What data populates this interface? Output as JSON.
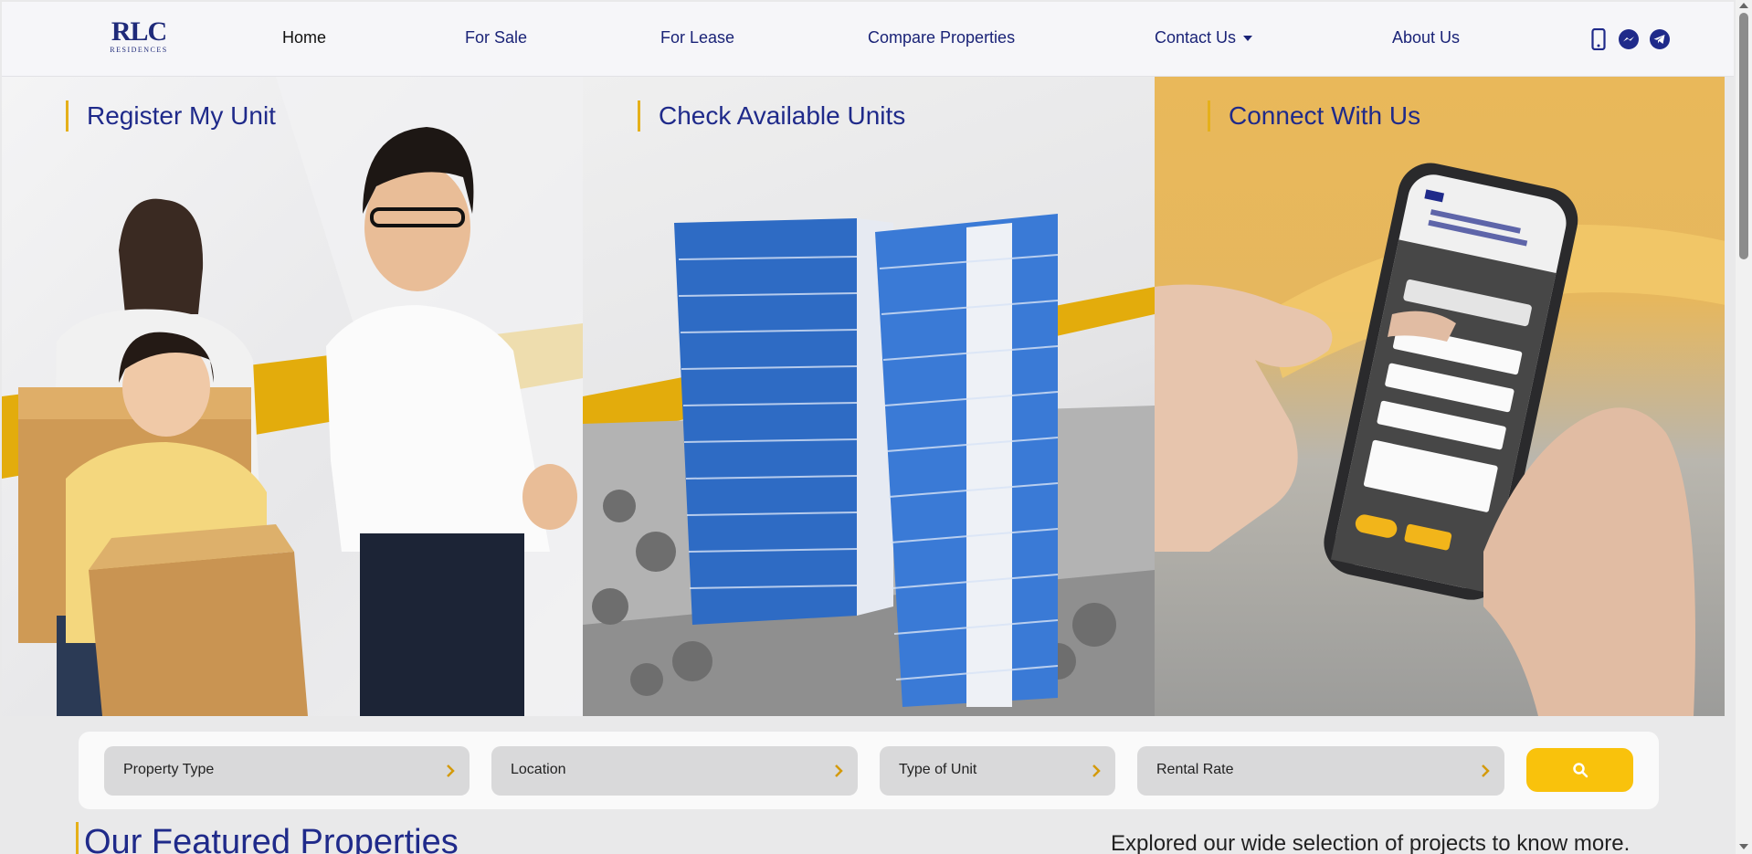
{
  "brand": {
    "logo_mark": "RLC",
    "logo_sub": "RESIDENCES"
  },
  "nav": {
    "home": "Home",
    "for_sale": "For Sale",
    "for_lease": "For Lease",
    "compare": "Compare Properties",
    "contact": "Contact Us",
    "about": "About Us"
  },
  "social_icons": [
    "mobile-phone-icon",
    "messenger-icon",
    "telegram-icon"
  ],
  "hero": {
    "panels": [
      {
        "title": "Register My Unit"
      },
      {
        "title": "Check Available Units"
      },
      {
        "title": "Connect With Us"
      }
    ]
  },
  "search": {
    "filters": [
      {
        "label": "Property Type"
      },
      {
        "label": "Location"
      },
      {
        "label": "Type of Unit"
      },
      {
        "label": "Rental Rate"
      }
    ],
    "button_icon": "search-icon"
  },
  "featured": {
    "title": "Our Featured Properties",
    "subtitle": "Explored our wide selection of projects to know more."
  },
  "colors": {
    "brand_blue": "#1f2a8a",
    "accent_yellow": "#f9c20c",
    "accent_gold": "#e5b01a"
  }
}
